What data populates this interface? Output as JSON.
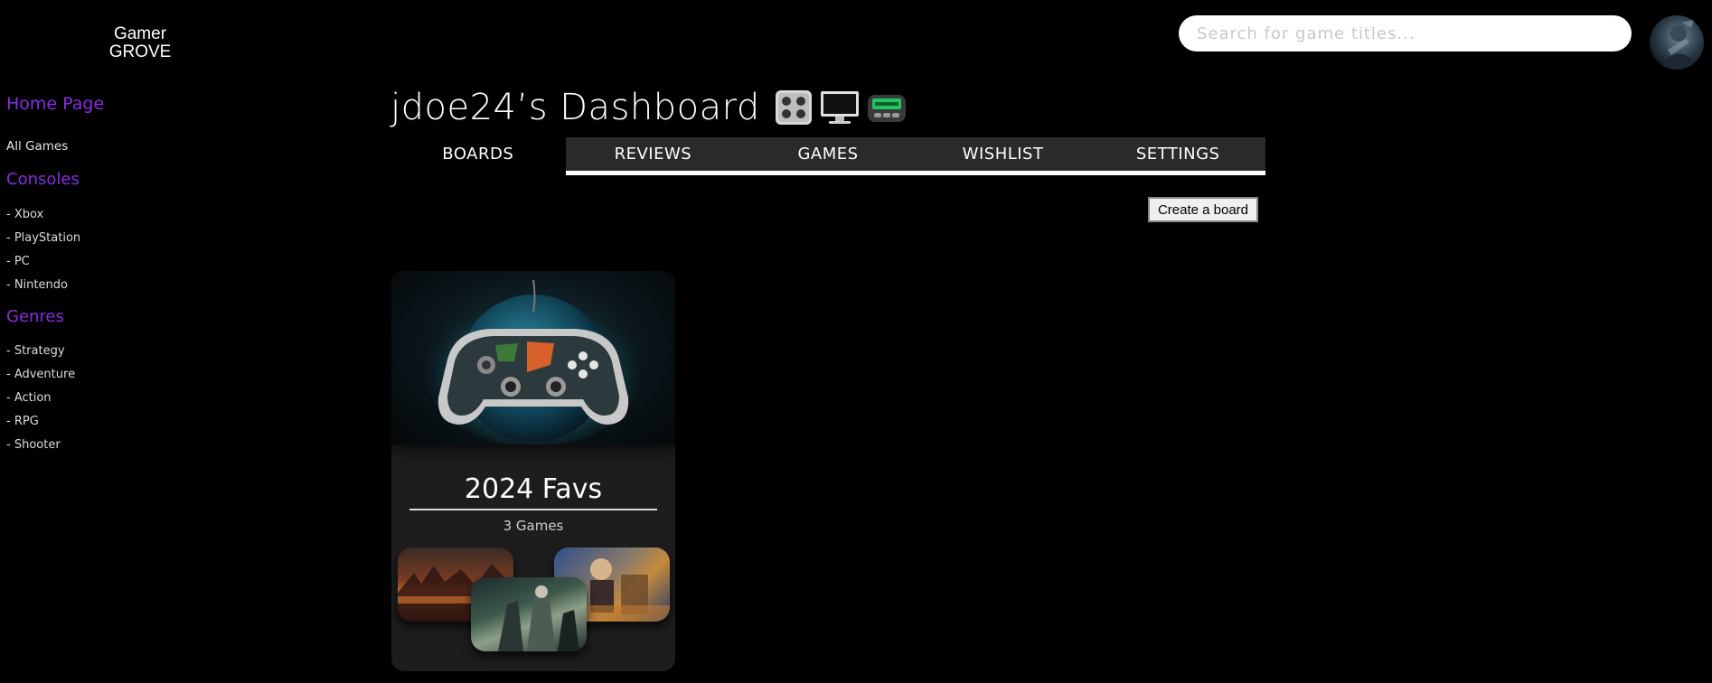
{
  "header": {
    "logo_line1": "Gamer",
    "logo_line2": "GROVE",
    "search_placeholder": "Search for game titles...",
    "avatar_icon": "user-avatar-icon"
  },
  "sidebar": {
    "home": "Home Page",
    "all_games": "All Games",
    "consoles_heading": "Consoles",
    "consoles": [
      "- Xbox",
      "- PlayStation",
      "- PC",
      "- Nintendo"
    ],
    "genres_heading": "Genres",
    "genres": [
      "- Strategy",
      "- Adventure",
      "- Action",
      "- RPG",
      "- Shooter"
    ]
  },
  "main": {
    "title": "jdoe24’s Dashboard",
    "title_icons": [
      "gamepad-icon",
      "monitor-icon",
      "pager-icon"
    ],
    "tabs": [
      "BOARDS",
      "REVIEWS",
      "GAMES",
      "WISHLIST",
      "SETTINGS"
    ],
    "active_tab": "BOARDS",
    "create_board_label": "Create a board"
  },
  "boards": [
    {
      "title": "2024 Favs",
      "count": "3 Games"
    }
  ],
  "colors": {
    "accent": "#8a2be2",
    "background": "#000000",
    "tab_bg": "#2a2a2a",
    "card_bg": "#1d1d1d"
  }
}
